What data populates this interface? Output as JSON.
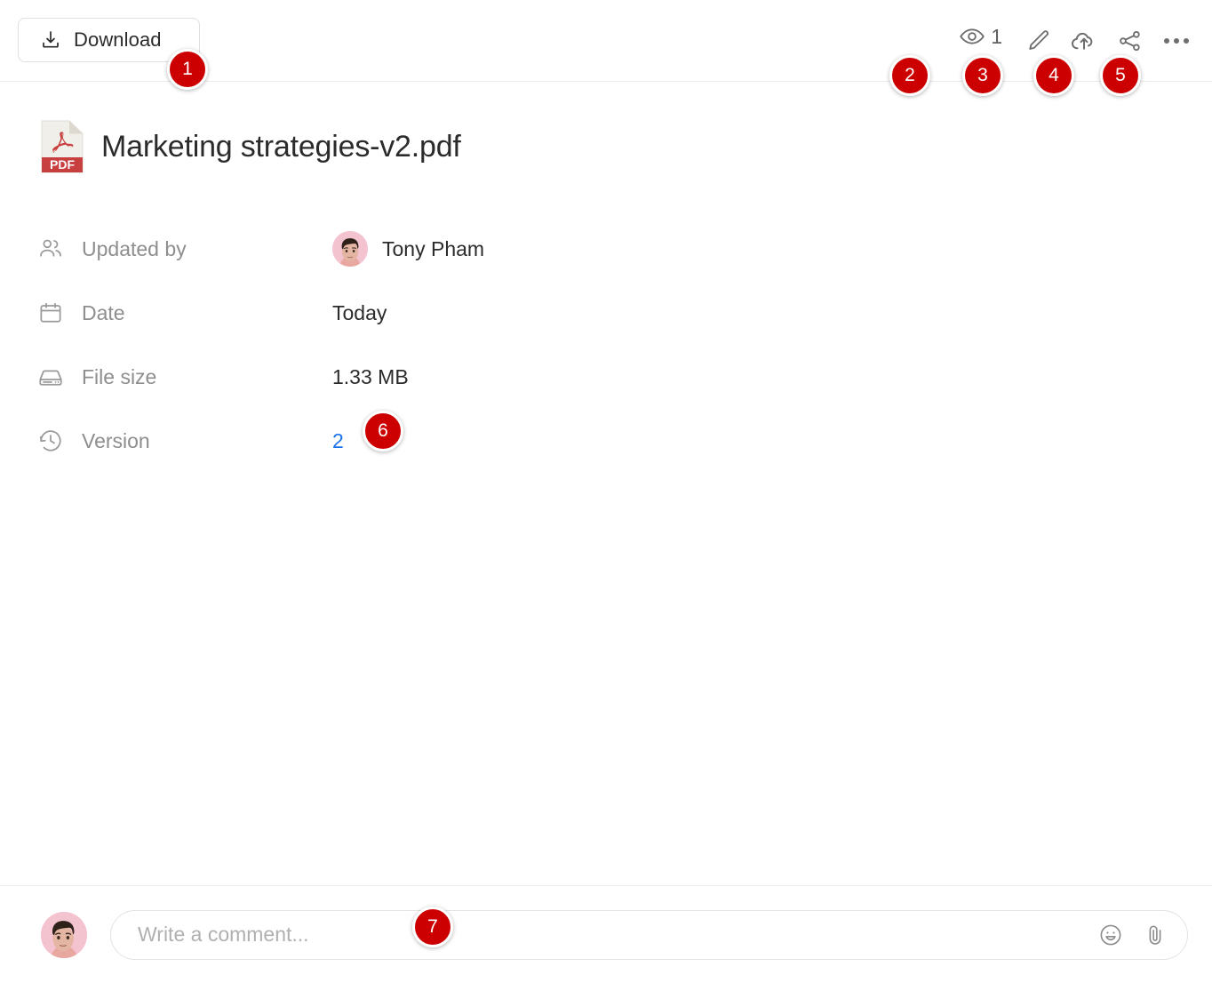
{
  "toolbar": {
    "download_label": "Download",
    "download_icon": "download-icon",
    "views_count": "1",
    "views_icon": "eye-icon",
    "edit_icon": "pencil-icon",
    "upload_icon": "cloud-upload-icon",
    "share_icon": "share-icon",
    "more_icon": "more-horizontal-icon"
  },
  "file": {
    "name": "Marketing strategies-v2.pdf",
    "type_label": "PDF",
    "icon": "pdf-file-icon"
  },
  "details": [
    {
      "icon": "people-icon",
      "label": "Updated by",
      "value": "Tony Pham",
      "has_avatar": true,
      "is_link": false
    },
    {
      "icon": "calendar-icon",
      "label": "Date",
      "value": "Today",
      "has_avatar": false,
      "is_link": false
    },
    {
      "icon": "hard-drive-icon",
      "label": "File size",
      "value": "1.33 MB",
      "has_avatar": false,
      "is_link": false
    },
    {
      "icon": "clock-history-icon",
      "label": "Version",
      "value": "2",
      "has_avatar": false,
      "is_link": true
    }
  ],
  "comment": {
    "placeholder": "Write a comment...",
    "value": "",
    "emoji_icon": "emoji-icon",
    "attach_icon": "paperclip-icon",
    "avatar_name": "user-avatar"
  },
  "annotations": [
    {
      "number": "1",
      "target": "download-button"
    },
    {
      "number": "2",
      "target": "views-indicator"
    },
    {
      "number": "3",
      "target": "edit-button"
    },
    {
      "number": "4",
      "target": "upload-button"
    },
    {
      "number": "5",
      "target": "share-button"
    },
    {
      "number": "6",
      "target": "version-link"
    },
    {
      "number": "7",
      "target": "comment-input"
    }
  ],
  "colors": {
    "badge": "#cc0000",
    "link": "#1a73e8",
    "pdf_red": "#c7403f",
    "divider": "#ebebeb",
    "muted_text": "#8e8e8e"
  }
}
